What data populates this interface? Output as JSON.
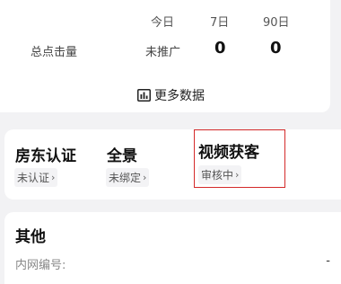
{
  "stats": {
    "headers": {
      "today": "今日",
      "d7": "7日",
      "d90": "90日"
    },
    "row_label": "总点击量",
    "today_value": "未推广",
    "d7_value": "0",
    "d90_value": "0",
    "more_label": "更多数据",
    "more_icon": "bar-chart-icon"
  },
  "verify": {
    "items": [
      {
        "title": "房东认证",
        "status": "未认证"
      },
      {
        "title": "全景",
        "status": "未绑定"
      },
      {
        "title": "视频获客",
        "status": "审核中"
      }
    ],
    "chevron": "›",
    "highlight_color": "#d42a2a"
  },
  "other": {
    "title": "其他",
    "field_label": "内网编号:",
    "field_value": "-"
  }
}
